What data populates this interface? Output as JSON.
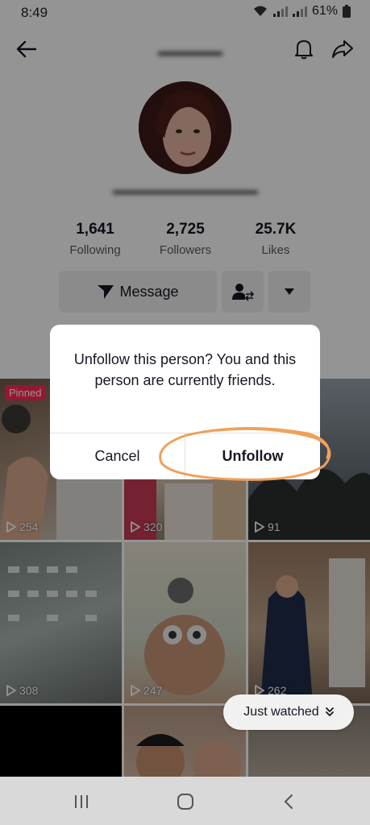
{
  "status_bar": {
    "time": "8:49",
    "battery": "61%"
  },
  "profile": {
    "stats": [
      {
        "value": "1,641",
        "label": "Following"
      },
      {
        "value": "2,725",
        "label": "Followers"
      },
      {
        "value": "25.7K",
        "label": "Likes"
      }
    ],
    "message_label": "Message"
  },
  "videos": [
    {
      "views": "254",
      "pinned_label": "Pinned"
    },
    {
      "views": "320"
    },
    {
      "views": "91"
    },
    {
      "views": "308"
    },
    {
      "views": "247"
    },
    {
      "views": "262"
    }
  ],
  "dialog": {
    "message": "Unfollow this person? You and this person are currently friends.",
    "cancel_label": "Cancel",
    "unfollow_label": "Unfollow"
  },
  "just_watched_label": "Just watched",
  "colors": {
    "pinned_badge": "#fe2c55",
    "annotation_circle": "#f0a05a"
  }
}
